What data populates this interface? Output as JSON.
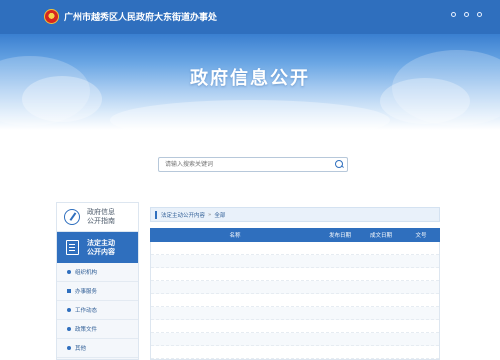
{
  "header": {
    "site_title": "广州市越秀区人民政府大东街道办事处",
    "banner_title": "政府信息公开"
  },
  "search": {
    "placeholder": "请输入搜索关键词"
  },
  "sidebar": {
    "guide_line1": "政府信息",
    "guide_line2": "公开指南",
    "active_line1": "法定主动",
    "active_line2": "公开内容",
    "items": [
      {
        "label": "组织机构"
      },
      {
        "label": "办事服务"
      },
      {
        "label": "工作动态"
      },
      {
        "label": "政策文件"
      },
      {
        "label": "其他"
      }
    ]
  },
  "breadcrumb": {
    "items": [
      "法定主动公开内容",
      "全部"
    ]
  },
  "table": {
    "headers": [
      "名称",
      "发布日期",
      "成文日期",
      "文号"
    ]
  }
}
